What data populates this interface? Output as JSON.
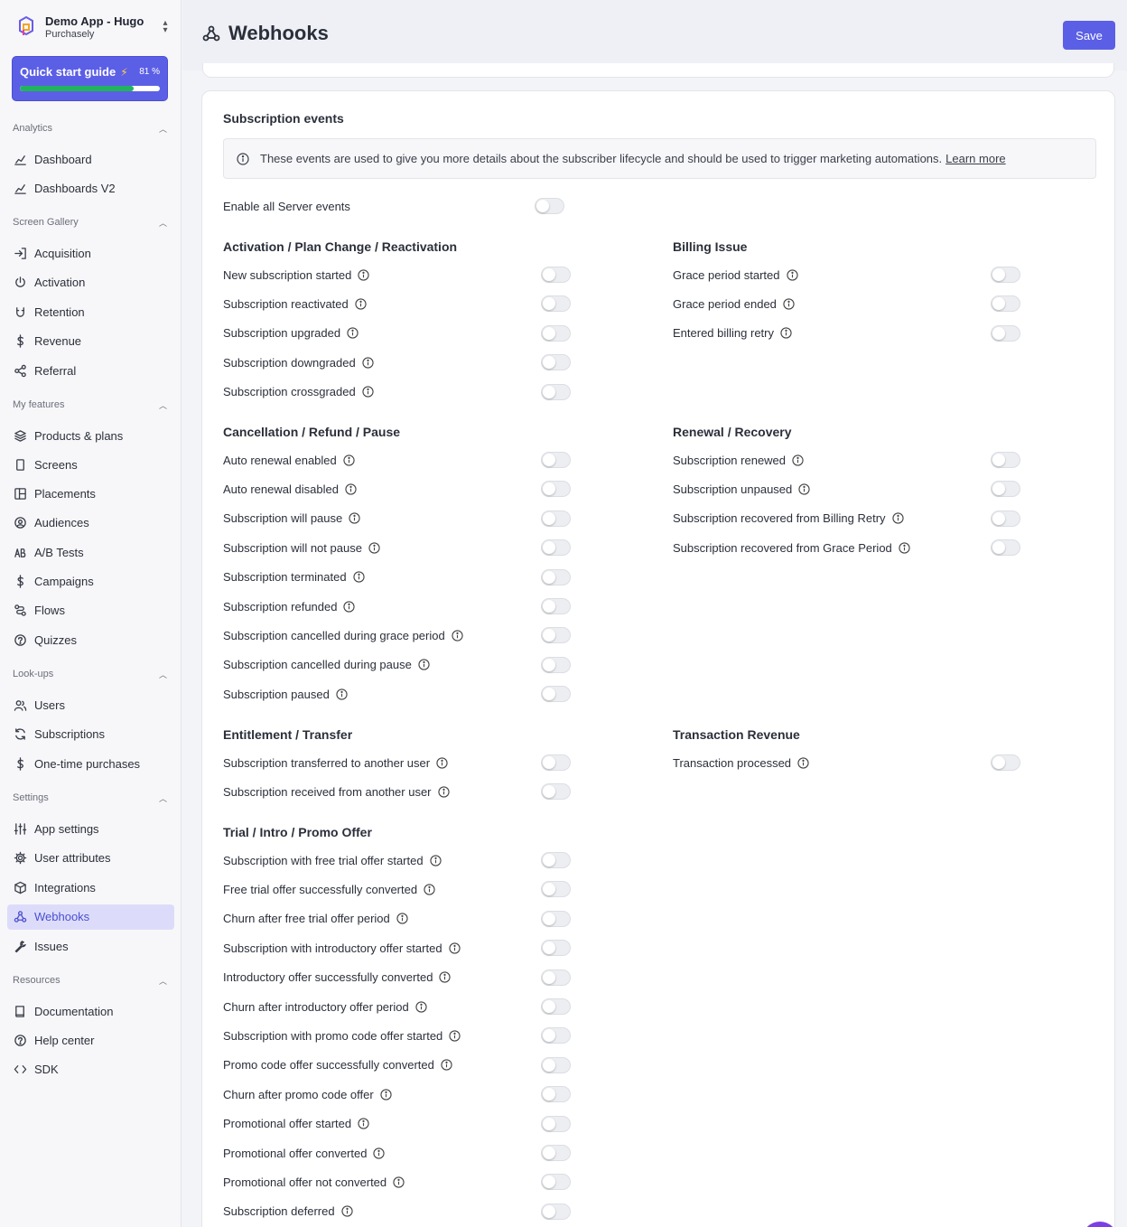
{
  "app": {
    "name": "Demo App - Hugo",
    "org": "Purchasely"
  },
  "quick_start": {
    "label": "Quick start guide",
    "percent_label": "81 %",
    "progress": 0.81
  },
  "nav": {
    "analytics": {
      "title": "Analytics",
      "items": [
        {
          "label": "Dashboard",
          "icon": "chart-line-icon"
        },
        {
          "label": "Dashboards V2",
          "icon": "chart-line-icon"
        }
      ]
    },
    "screen_gallery": {
      "title": "Screen Gallery",
      "items": [
        {
          "label": "Acquisition",
          "icon": "login-arrow-icon"
        },
        {
          "label": "Activation",
          "icon": "power-icon"
        },
        {
          "label": "Retention",
          "icon": "magnet-icon"
        },
        {
          "label": "Revenue",
          "icon": "dollar-icon"
        },
        {
          "label": "Referral",
          "icon": "share-icon"
        }
      ]
    },
    "my_features": {
      "title": "My features",
      "items": [
        {
          "label": "Products & plans",
          "icon": "layers-icon"
        },
        {
          "label": "Screens",
          "icon": "phone-icon"
        },
        {
          "label": "Placements",
          "icon": "layout-icon"
        },
        {
          "label": "Audiences",
          "icon": "audience-icon"
        },
        {
          "label": "A/B Tests",
          "icon": "ab-test-icon"
        },
        {
          "label": "Campaigns",
          "icon": "dollar-icon"
        },
        {
          "label": "Flows",
          "icon": "flow-icon"
        },
        {
          "label": "Quizzes",
          "icon": "question-icon"
        }
      ]
    },
    "lookups": {
      "title": "Look-ups",
      "items": [
        {
          "label": "Users",
          "icon": "users-icon"
        },
        {
          "label": "Subscriptions",
          "icon": "refresh-icon"
        },
        {
          "label": "One-time purchases",
          "icon": "dollar-icon"
        }
      ]
    },
    "settings": {
      "title": "Settings",
      "items": [
        {
          "label": "App settings",
          "icon": "sliders-icon"
        },
        {
          "label": "User attributes",
          "icon": "gear-icon"
        },
        {
          "label": "Integrations",
          "icon": "package-icon"
        },
        {
          "label": "Webhooks",
          "icon": "webhook-icon",
          "active": true
        },
        {
          "label": "Issues",
          "icon": "wrench-icon"
        }
      ]
    },
    "resources": {
      "title": "Resources",
      "items": [
        {
          "label": "Documentation",
          "icon": "book-icon"
        },
        {
          "label": "Help center",
          "icon": "help-icon"
        },
        {
          "label": "SDK",
          "icon": "code-icon"
        }
      ]
    }
  },
  "header": {
    "title": "Webhooks",
    "save_label": "Save"
  },
  "section": {
    "title": "Subscription events",
    "info_text": "These events are used to give you more details about the subscriber lifecycle and should be used to trigger marketing automations.",
    "learn_more": "Learn more",
    "enable_all_label": "Enable all Server events",
    "enable_all_on": false
  },
  "groups": {
    "activation": {
      "title": "Activation / Plan Change / Reactivation",
      "events": [
        "New subscription started",
        "Subscription reactivated",
        "Subscription upgraded",
        "Subscription downgraded",
        "Subscription crossgraded"
      ]
    },
    "billing": {
      "title": "Billing Issue",
      "events": [
        "Grace period started",
        "Grace period ended",
        "Entered billing retry"
      ]
    },
    "cancellation": {
      "title": "Cancellation / Refund / Pause",
      "events": [
        "Auto renewal enabled",
        "Auto renewal disabled",
        "Subscription will pause",
        "Subscription will not pause",
        "Subscription terminated",
        "Subscription refunded",
        "Subscription cancelled during grace period",
        "Subscription cancelled during pause",
        "Subscription paused"
      ]
    },
    "renewal": {
      "title": "Renewal / Recovery",
      "events": [
        "Subscription renewed",
        "Subscription unpaused",
        "Subscription recovered from Billing Retry",
        "Subscription recovered from Grace Period"
      ]
    },
    "entitlement": {
      "title": "Entitlement / Transfer",
      "events": [
        "Subscription transferred to another user",
        "Subscription received from another user"
      ]
    },
    "transaction": {
      "title": "Transaction Revenue",
      "events": [
        "Transaction processed"
      ]
    },
    "trial": {
      "title": "Trial / Intro / Promo Offer",
      "events": [
        "Subscription with free trial offer started",
        "Free trial offer successfully converted",
        "Churn after free trial offer period",
        "Subscription with introductory offer started",
        "Introductory offer successfully converted",
        "Churn after introductory offer period",
        "Subscription with promo code offer started",
        "Promo code offer successfully converted",
        "Churn after promo code offer",
        "Promotional offer started",
        "Promotional offer converted",
        "Promotional offer not converted",
        "Subscription deferred"
      ]
    }
  },
  "colors": {
    "accent": "#5b5fe6",
    "progress": "#22b35e",
    "active_nav_bg": "#dcdcfa"
  }
}
